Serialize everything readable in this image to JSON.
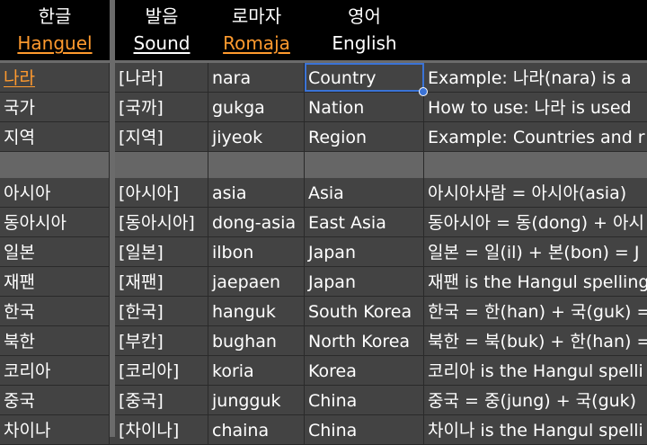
{
  "header": {
    "col1": {
      "ko": "한글",
      "en": "Hanguel"
    },
    "col2": {
      "ko": "발음",
      "en": "Sound"
    },
    "col3": {
      "ko": "로마자",
      "en": "Romaja"
    },
    "col4": {
      "ko": "영어",
      "en": "English"
    }
  },
  "rows": [
    {
      "hangul": "나라",
      "sound": "[나라]",
      "romaja": "nara",
      "english": "Country",
      "note": "Example: 나라(nara) is a"
    },
    {
      "hangul": "국가",
      "sound": "[국까]",
      "romaja": "gukga",
      "english": "Nation",
      "note": "How to use: 나라 is used"
    },
    {
      "hangul": "지역",
      "sound": "[지역]",
      "romaja": "jiyeok",
      "english": "Region",
      "note": "Example: Countries and r"
    },
    {
      "hangul": "",
      "sound": "",
      "romaja": "",
      "english": "",
      "note": ""
    },
    {
      "hangul": "아시아",
      "sound": "[아시아]",
      "romaja": "asia",
      "english": "Asia",
      "note": "아시아사람 = 아시아(asia)"
    },
    {
      "hangul": "동아시아",
      "sound": "[동아시아]",
      "romaja": "dong-asia",
      "english": "East Asia",
      "note": "동아시아 = 동(dong) + 아시"
    },
    {
      "hangul": "일본",
      "sound": "[일본]",
      "romaja": "ilbon",
      "english": "Japan",
      "note": "일본 = 일(il) + 본(bon) = J"
    },
    {
      "hangul": "재팬",
      "sound": "[재팬]",
      "romaja": "jaepaen",
      "english": "Japan",
      "note": "재팬 is the Hangul spelling"
    },
    {
      "hangul": "한국",
      "sound": "[한국]",
      "romaja": "hanguk",
      "english": "South Korea",
      "note": "한국 = 한(han) + 국(guk) ="
    },
    {
      "hangul": "북한",
      "sound": "[부칸]",
      "romaja": "bughan",
      "english": "North Korea",
      "note": "북한 = 북(buk) + 한(han) ="
    },
    {
      "hangul": "코리아",
      "sound": "[코리아]",
      "romaja": "koria",
      "english": "Korea",
      "note": "코리아 is the Hangul spelli"
    },
    {
      "hangul": "중국",
      "sound": "[중국]",
      "romaja": "jungguk",
      "english": "China",
      "note": "중국 = 중(jung) + 국(guk)"
    },
    {
      "hangul": "차이나",
      "sound": "[차이나]",
      "romaja": "chaina",
      "english": "China",
      "note": "차이나 is the Hangul spelli"
    }
  ]
}
